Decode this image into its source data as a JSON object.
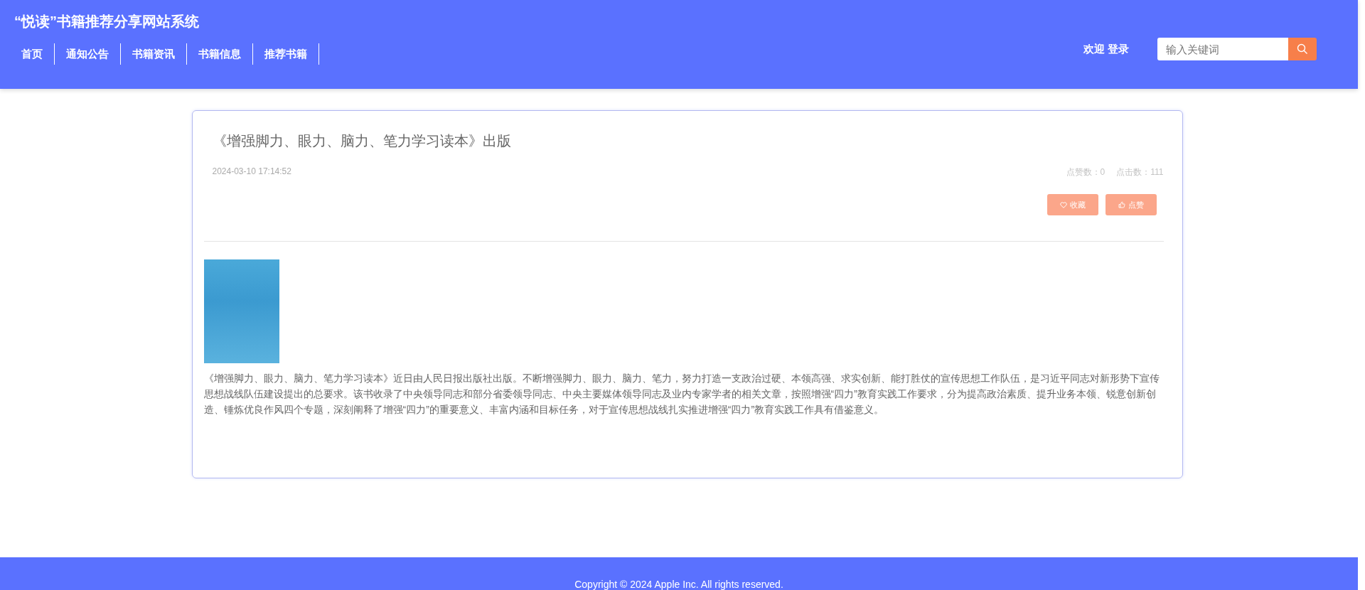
{
  "site_title": "“悦读”书籍推荐分享网站系统",
  "nav": [
    {
      "label": "首页"
    },
    {
      "label": "通知公告"
    },
    {
      "label": "书籍资讯"
    },
    {
      "label": "书籍信息"
    },
    {
      "label": "推荐书籍"
    }
  ],
  "user_links": [
    "欢迎",
    "登录"
  ],
  "search": {
    "placeholder": "输入关键词"
  },
  "article": {
    "title": "《增强脚力、眼力、脑力、笔力学习读本》出版",
    "date": "2024-03-10 17:14:52",
    "likes": "点赞数：0",
    "clicks": "点击数：111",
    "buttons": [
      {
        "label": "收藏",
        "kind": "favorite"
      },
      {
        "label": "点赞",
        "kind": "like"
      }
    ],
    "body": "《增强脚力、眼力、脑力、笔力学习读本》近日由人民日报出版社出版。不断增强脚力、眼力、脑力、笔力，努力打造一支政治过硬、本领高强、求实创新、能打胜仗的宣传思想工作队伍，是习近平同志对新形势下宣传思想战线队伍建设提出的总要求。该书收录了中央领导同志和部分省委领导同志、中央主要媒体领导同志及业内专家学者的相关文章，按照增强“四力”教育实践工作要求，分为提高政治素质、提升业务本领、锐意创新创造、锤炼优良作风四个专题，深刻阐释了增强“四力”的重要意义、丰富内涵和目标任务，对于宣传思想战线扎实推进增强“四力”教育实践工作具有借鉴意义。"
  },
  "footer": "Copyright © 2024 Apple Inc. All rights reserved."
}
